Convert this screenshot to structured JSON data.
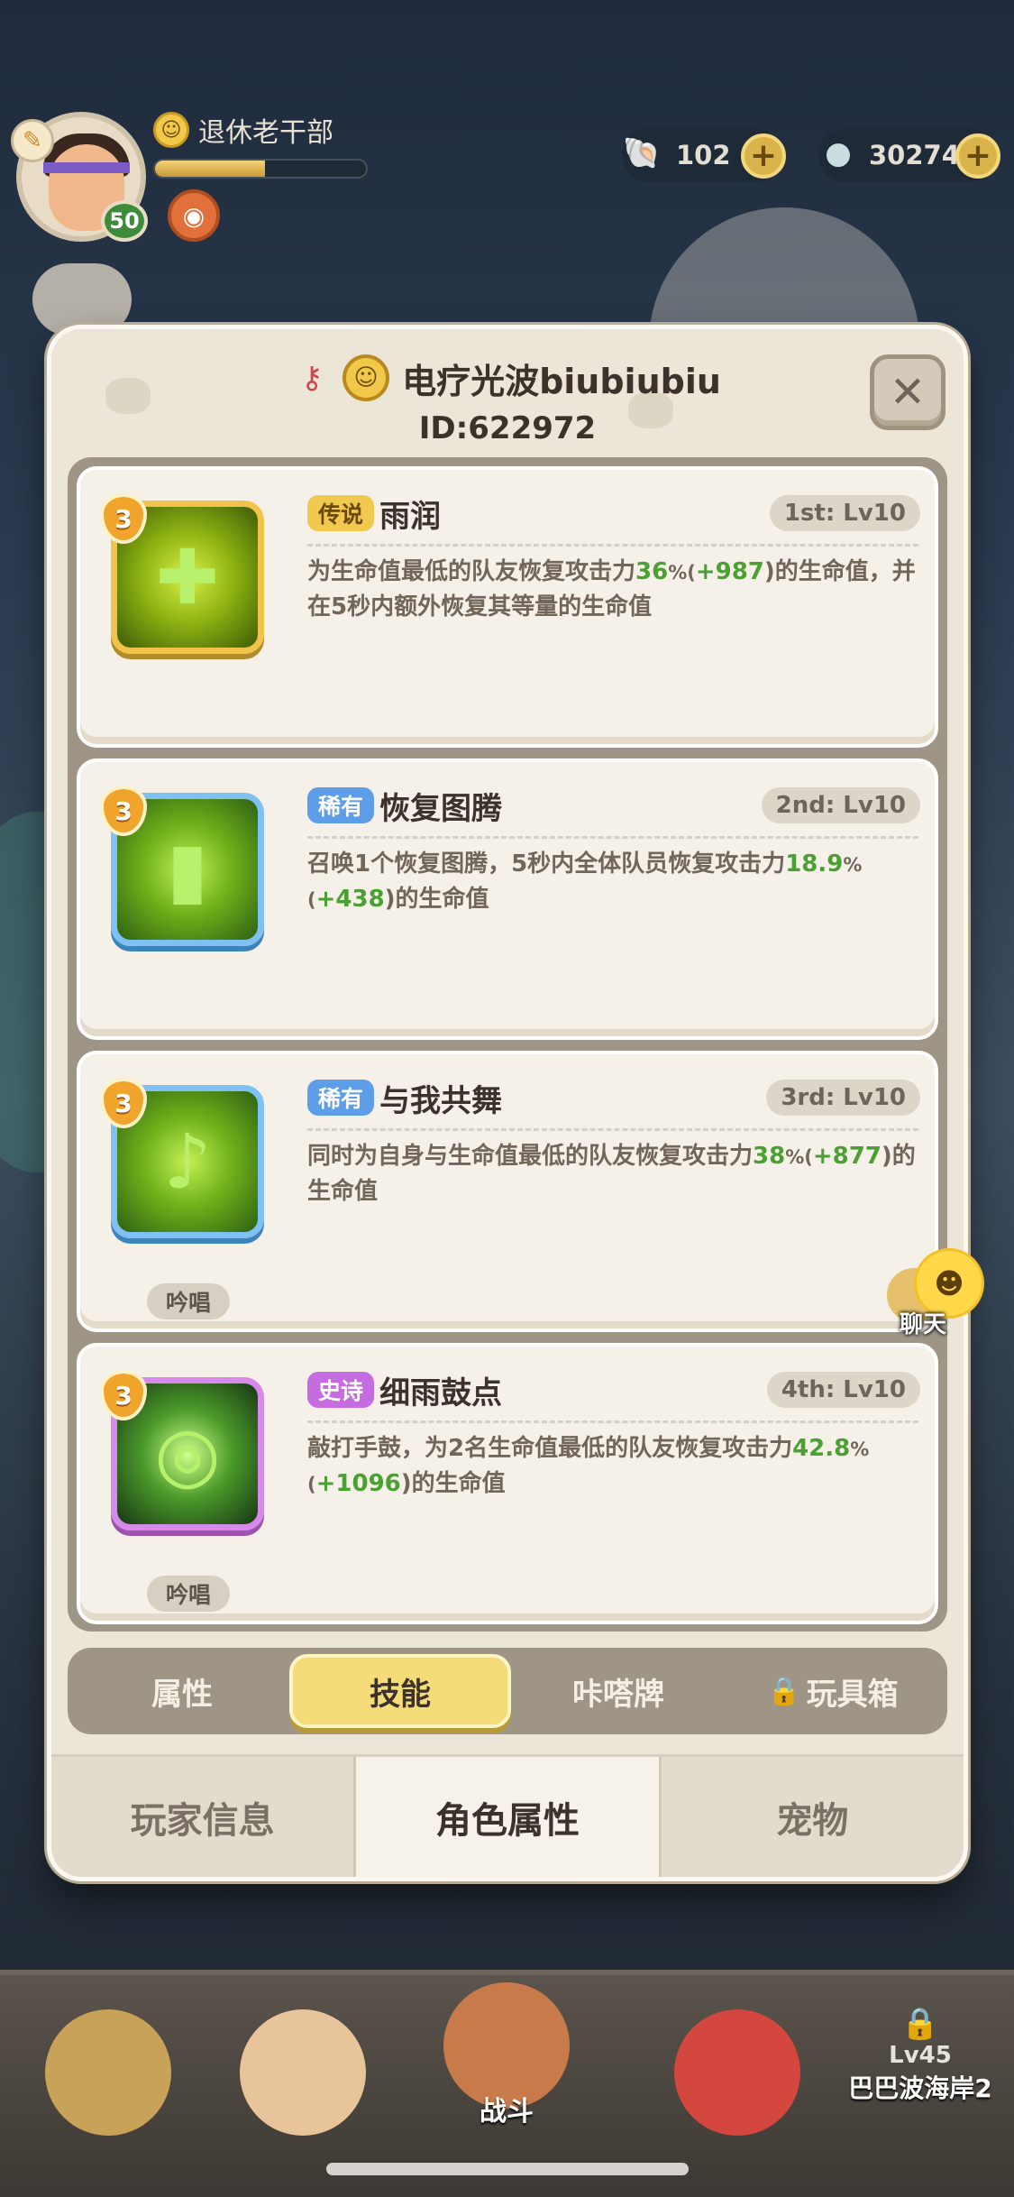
{
  "hud": {
    "player_name": "退休老干部",
    "level": "50",
    "xp_progress": 0.52,
    "currency_shells": "102",
    "currency_pearls": "30274"
  },
  "profile": {
    "name": "电疗光波biubiubiu",
    "id_text": "ID:622972"
  },
  "skills": [
    {
      "level": "3",
      "rarity": "传说",
      "name": "雨润",
      "rank": "1st: Lv10",
      "desc_1": "为生命值最低的队友恢复攻击力",
      "pct": "36",
      "pct_unit": "%(",
      "bonus": "+987",
      "desc_2": ")的生命值，并在5秒内额外恢复其等量的生命值",
      "tag": ""
    },
    {
      "level": "3",
      "rarity": "稀有",
      "name": "恢复图腾",
      "rank": "2nd: Lv10",
      "desc_1": "召唤1个恢复图腾，5秒内全体队员恢复攻击力",
      "pct": "18.9",
      "pct_unit": "%(",
      "bonus": "+438",
      "desc_2": ")的生命值",
      "tag": ""
    },
    {
      "level": "3",
      "rarity": "稀有",
      "name": "与我共舞",
      "rank": "3rd: Lv10",
      "desc_1": "同时为自身与生命值最低的队友恢复攻击力",
      "pct": "38",
      "pct_unit": "%(",
      "bonus": "+877",
      "desc_2": ")的生命值",
      "tag": "吟唱"
    },
    {
      "level": "3",
      "rarity": "史诗",
      "name": "细雨鼓点",
      "rank": "4th: Lv10",
      "desc_1": "敲打手鼓，为2名生命值最低的队友恢复攻击力",
      "pct": "42.8",
      "pct_unit": "%(",
      "bonus": "+1096",
      "desc_2": ")的生命值",
      "tag": "吟唱"
    }
  ],
  "sub_tabs": [
    "属性",
    "技能",
    "咔嗒牌",
    "玩具箱"
  ],
  "main_tabs": [
    "玩家信息",
    "角色属性",
    "宠物"
  ],
  "chat_label": "聊天",
  "bottom_nav": {
    "battle_label": "战斗",
    "locked_level": "Lv45",
    "locked_place": "巴巴波海岸2"
  },
  "colors": {
    "legend": "#f0c94e",
    "rare": "#5e9ee8",
    "epic": "#c46ce0",
    "highlight_green": "#4aa033",
    "active_tab": "#f6dc78"
  }
}
